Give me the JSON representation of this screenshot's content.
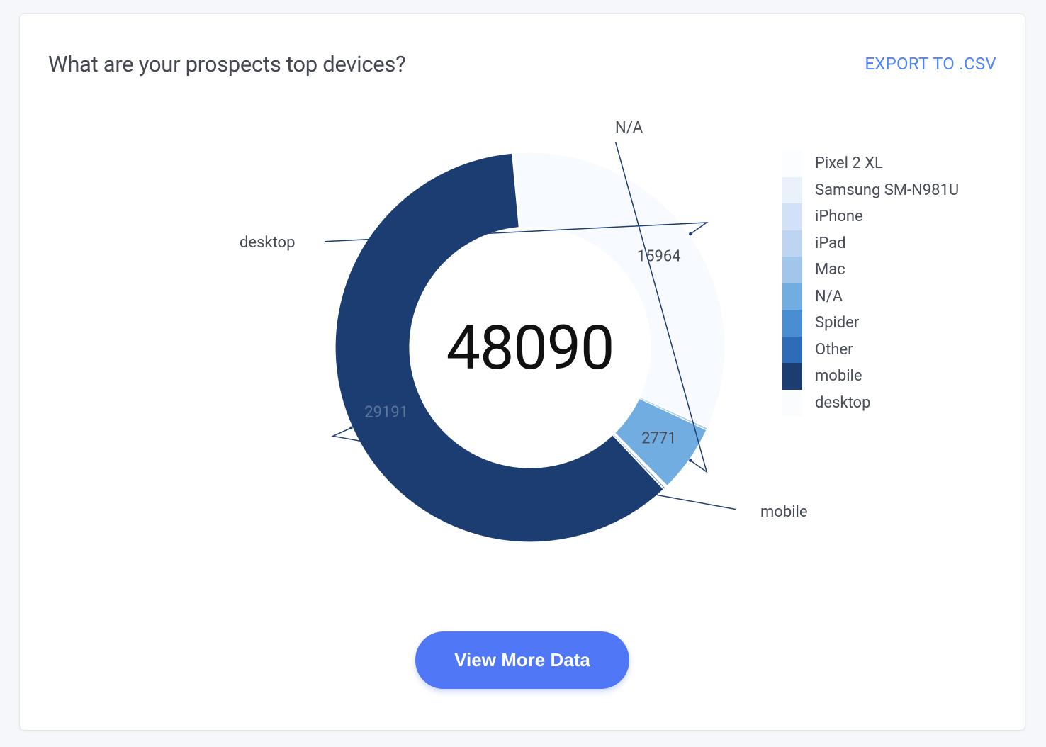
{
  "header": {
    "title": "What are your prospects top devices?",
    "export_label": "EXPORT TO .CSV"
  },
  "footer": {
    "button_label": "View More Data"
  },
  "center_total": "48090",
  "legend": [
    {
      "label": "Pixel 2 XL",
      "color": "#fcfdff"
    },
    {
      "label": "Samsung SM-N981U",
      "color": "#e9f1fb"
    },
    {
      "label": "iPhone",
      "color": "#d3e1f6"
    },
    {
      "label": "iPad",
      "color": "#bdd5f1"
    },
    {
      "label": "Mac",
      "color": "#a1c6ea"
    },
    {
      "label": "N/A",
      "color": "#72ade2"
    },
    {
      "label": "Spider",
      "color": "#4a8ed2"
    },
    {
      "label": "Other",
      "color": "#2f6cb7"
    },
    {
      "label": "mobile",
      "color": "#1c3d72"
    },
    {
      "label": "desktop",
      "color": "#fbfcfe"
    }
  ],
  "callouts": {
    "desktop_label": "desktop",
    "desktop_value": "15964",
    "na_label": "N/A",
    "na_value": "2771",
    "mobile_label": "mobile",
    "mobile_value": "29191"
  },
  "chart_data": {
    "type": "pie",
    "title": "What are your prospects top devices?",
    "total": 48090,
    "series": [
      {
        "name": "mobile",
        "value": 29191,
        "color": "#1c3d72"
      },
      {
        "name": "desktop",
        "value": 15964,
        "color": "#f7fafe"
      },
      {
        "name": "N/A",
        "value": 2771,
        "color": "#72ade2"
      },
      {
        "name": "Spider",
        "value": 80,
        "color": "#4a8ed2"
      },
      {
        "name": "Other",
        "value": 40,
        "color": "#2f6cb7"
      },
      {
        "name": "Pixel 2 XL",
        "value": 15,
        "color": "#fcfdff"
      },
      {
        "name": "Samsung SM-N981U",
        "value": 10,
        "color": "#e9f1fb"
      },
      {
        "name": "iPhone",
        "value": 8,
        "color": "#d3e1f6"
      },
      {
        "name": "iPad",
        "value": 6,
        "color": "#bdd5f1"
      },
      {
        "name": "Mac",
        "value": 5,
        "color": "#a1c6ea"
      }
    ]
  }
}
